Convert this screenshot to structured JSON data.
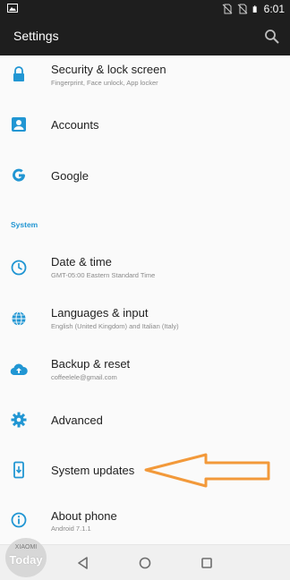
{
  "status_bar": {
    "time": "6:01",
    "icons": [
      "image-icon",
      "no-sim-icon",
      "no-sim-icon",
      "battery-icon"
    ]
  },
  "app_bar": {
    "title": "Settings",
    "search_icon": "search-icon"
  },
  "items_top": [
    {
      "label": "Security & lock screen",
      "sub": "Fingerprint, Face unlock, App locker",
      "icon": "lock-icon"
    },
    {
      "label": "Accounts",
      "sub": "",
      "icon": "account-box-icon"
    },
    {
      "label": "Google",
      "sub": "",
      "icon": "google-icon"
    }
  ],
  "section": {
    "title": "System"
  },
  "items_system": [
    {
      "label": "Date & time",
      "sub": "GMT-05:00 Eastern Standard Time",
      "icon": "clock-icon"
    },
    {
      "label": "Languages & input",
      "sub": "English (United Kingdom) and Italian (Italy)",
      "icon": "globe-icon"
    },
    {
      "label": "Backup & reset",
      "sub": "coffeelele@gmail.com",
      "icon": "cloud-upload-icon"
    },
    {
      "label": "Advanced",
      "sub": "",
      "icon": "gear-icon"
    },
    {
      "label": "System updates",
      "sub": "",
      "icon": "phone-update-icon"
    },
    {
      "label": "About phone",
      "sub": "Android 7.1.1",
      "icon": "info-icon"
    }
  ],
  "nav_bar": {
    "icons": [
      "back-icon",
      "home-icon",
      "recents-icon"
    ]
  },
  "watermark": {
    "top": "XIAOMI",
    "bottom": "Today"
  },
  "colors": {
    "accent": "#2196d3",
    "bar": "#1e1e1e",
    "arrow": "#f2993a"
  }
}
